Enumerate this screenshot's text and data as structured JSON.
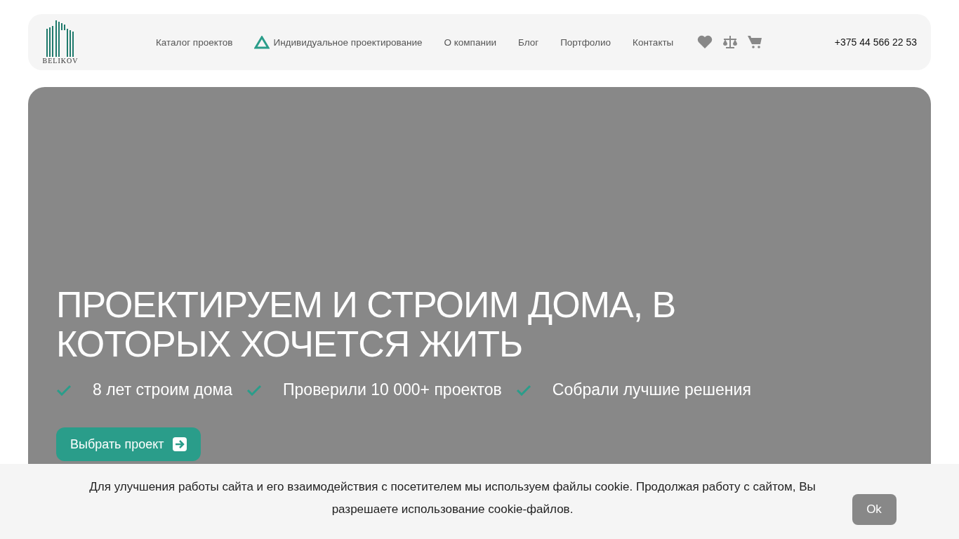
{
  "logo": {
    "text": "BELIKOV"
  },
  "nav": [
    {
      "label": "Каталог проектов",
      "kind": "plain"
    },
    {
      "label": "Индивидуальное проектирование",
      "kind": "accent"
    },
    {
      "label": "О компании",
      "kind": "plain"
    },
    {
      "label": "Блог",
      "kind": "plain"
    },
    {
      "label": "Портфолио",
      "kind": "plain"
    },
    {
      "label": "Контакты",
      "kind": "plain"
    }
  ],
  "phone": "+375 44 566 22 53",
  "hero": {
    "title": "ПРОЕКТИРУЕМ И СТРОИМ ДОМА, В КОТОРЫХ ХОЧЕТСЯ ЖИТЬ",
    "features": [
      "8 лет строим дома",
      "Проверили 10 000+ проектов",
      "Собрали лучшие решения"
    ],
    "button": "Выбрать проект"
  },
  "cookie": {
    "text": "Для улучшения работы сайта и его взаимодействия с посетителем мы используем файлы cookie. Продолжая работу с сайтом, Вы разрешаете использование cookie-файлов.",
    "button": "Ok"
  }
}
